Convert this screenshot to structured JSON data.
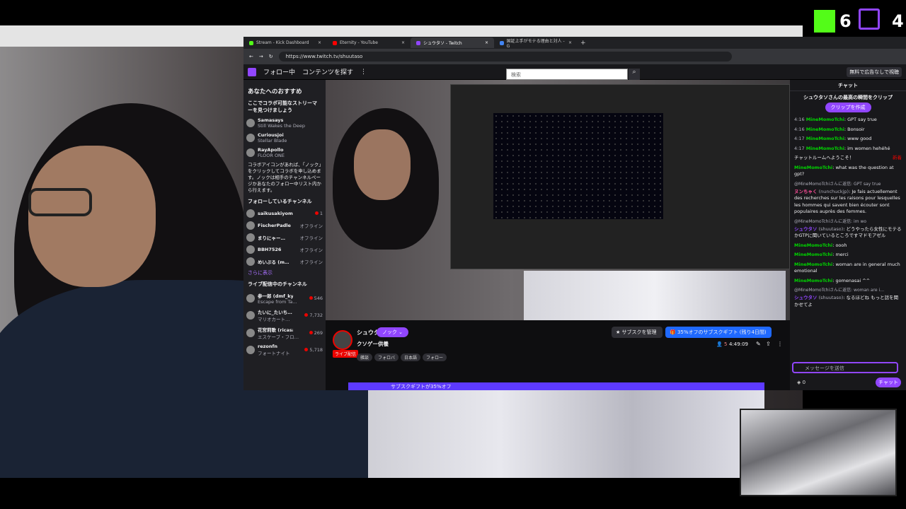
{
  "overlay": {
    "kick_count": "6",
    "twitch_count": "4"
  },
  "browser": {
    "tabs": [
      {
        "label": "Stream - Kick Dashboard",
        "color": "#53fc18"
      },
      {
        "label": "Eternity - YouTube",
        "color": "#ff0000"
      },
      {
        "label": "シュウタソ - Twitch",
        "color": "#9146ff"
      },
      {
        "label": "国証上手がモテる理由と対人 - G",
        "color": "#4285f4"
      }
    ],
    "url": "https://www.twitch.tv/shuutaso"
  },
  "twitch_nav": {
    "following": "フォロー中",
    "browse": "コンテンツを探す",
    "search_placeholder": "検索",
    "ad_free": "無料で広告なしで視聴"
  },
  "sidebar": {
    "recommended_title": "あなたへのおすすめ",
    "collab_title": "ここでコラボ可能なストリーマーを見つけましょう",
    "collab_channels": [
      {
        "name": "Samasays",
        "game": "Still Wakes the Deep"
      },
      {
        "name": "Curiousjoi",
        "game": "Stellar Blade"
      },
      {
        "name": "RayApollo",
        "game": "FLOOR ONE"
      }
    ],
    "collab_note": "コラボアイコンがあれば、「ノック」をクリックしてコラボを申し込めます。ノックは相手のチャンネルページかあなたのフォロー中リスト内から行えます。",
    "following_title": "フォローしているチャンネル",
    "following": [
      {
        "name": "saikusakiyomu",
        "status": "1",
        "sub": "雑談"
      },
      {
        "name": "FischerPadle",
        "status": "オフライン"
      },
      {
        "name": "まりにゃー…",
        "status": "オフライン"
      },
      {
        "name": "BBH7526",
        "status": "オフライン"
      },
      {
        "name": "めいぷる (m…",
        "status": "オフライン"
      }
    ],
    "show_more": "さらに表示",
    "live_title": "ライブ配信中のチャンネル",
    "live": [
      {
        "name": "参一郎 (dmf_ky…",
        "game": "Escape from Ta…",
        "viewers": "546"
      },
      {
        "name": "たいに_たいち…",
        "game": "マリオカート…",
        "viewers": "7,732"
      },
      {
        "name": "花宮莉歌 (ricasa…",
        "game": "エスケープ・フロ…",
        "viewers": "269"
      },
      {
        "name": "rezonfn",
        "game": "フォートナイト",
        "viewers": "5,718"
      }
    ]
  },
  "channel": {
    "name": "シュウタソ",
    "knock": "ノック",
    "title": "クソゲー供養",
    "live_badge": "ライブ配信",
    "tags": [
      "雑談",
      "フォロバ",
      "日本語",
      "フォロー"
    ],
    "viewers": "5",
    "uptime": "4:49:09",
    "manage_sub": "サブスクを管理",
    "gift_sub": "35%オフのサブスクギフト (残り4日間)",
    "banner": "サブスクギフトが35%オフ"
  },
  "chat": {
    "header": "チャット",
    "clip_title": "シュウタソさんの最高の瞬間をクリップ",
    "clip_button": "クリップを作成",
    "messages": [
      {
        "time": "4:16",
        "user": "MineMomoTchi",
        "text": ": GPT say true"
      },
      {
        "time": "4:16",
        "user": "MineMomoTchi",
        "text": ": Bonsoir"
      },
      {
        "time": "4:17",
        "user": "MineMomoTchi",
        "text": ": www good"
      },
      {
        "time": "4:17",
        "user": "MineMomoTchi",
        "text": ": im women hehéhé"
      }
    ],
    "welcome": "チャットルームへようこそ！",
    "new_label": "新着",
    "live_messages": [
      {
        "user": "MineMomoTchi",
        "text": ": what was the question at gpt?"
      },
      {
        "reply": "@MineMomoTchiさんに返信: GPT say true",
        "user": "ヌンちゃく",
        "handle": "(nunchuckjp)",
        "text": ": Je fais actuellement des recherches sur les raisons pour lesquelles les hommes qui savent bien écouter sont populaires auprès des femmes."
      },
      {
        "reply": "@MineMomoTchiさんに返信: im wo",
        "user": "シュウタソ",
        "handle": "(shuutaso)",
        "text": ": どうやったら女性にモテるかGTPに聞いているところですマドモアゼル"
      },
      {
        "user": "MineMomoTchi",
        "text": ": oooh"
      },
      {
        "user": "MineMomoTchi",
        "text": ": merci"
      },
      {
        "user": "MineMomoTchi",
        "text": ": woman are in general much emotional"
      },
      {
        "user": "MineMomoTchi",
        "text": ": gomenasai ^^"
      },
      {
        "reply": "@MineMomoTchiさんに返信: woman are i…",
        "user": "シュウタソ",
        "handle": "(shuutaso)",
        "text": ": なるほどね もっと話を聞かせてよ"
      }
    ],
    "input_placeholder": "メッセージを送信",
    "points": "0",
    "send": "チャット"
  }
}
